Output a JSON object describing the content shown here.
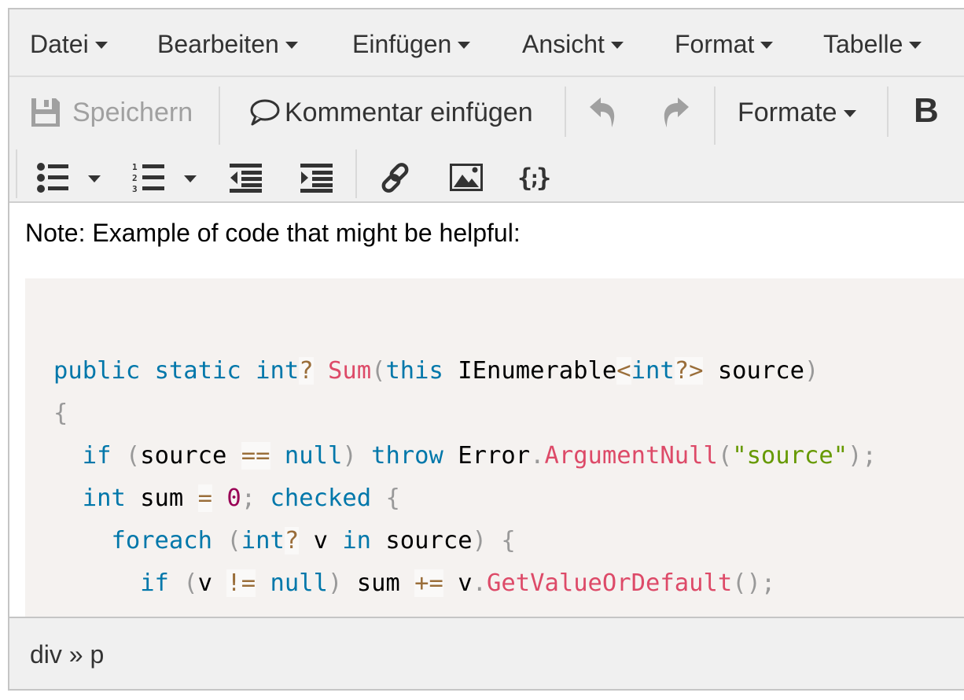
{
  "menubar": {
    "items": [
      {
        "label": "Datei"
      },
      {
        "label": "Bearbeiten"
      },
      {
        "label": "Einfügen"
      },
      {
        "label": "Ansicht"
      },
      {
        "label": "Format"
      },
      {
        "label": "Tabelle"
      }
    ]
  },
  "toolbar": {
    "save_label": "Speichern",
    "save_icon": "floppy-disk-icon",
    "comment_label": "Kommentar einfügen",
    "comment_icon": "speech-bubble-icon",
    "undo_icon": "undo-icon",
    "redo_icon": "redo-icon",
    "formats_label": "Formate",
    "bold_label": "B",
    "row2": [
      "bullet-list-icon",
      "numbered-list-icon",
      "outdent-icon",
      "indent-icon",
      "link-icon",
      "image-icon",
      "code-sample-icon"
    ]
  },
  "content": {
    "note": "Note: Example of code that might be helpful:",
    "code_lines": [
      "public static int? Sum(this IEnumerable<int?> source)",
      "{",
      "  if (source == null) throw Error.ArgumentNull(\"source\");",
      "  int sum = 0; checked {",
      "    foreach (int? v in source) {",
      "      if (v != null) sum += v.GetValueOrDefault();"
    ]
  },
  "statusbar": {
    "path": "div » p"
  },
  "colors": {
    "keyword": "#0077aa",
    "function": "#dd4a68",
    "punctuation": "#999999",
    "operator": "#9a6e3a",
    "string": "#669900",
    "number": "#990055",
    "code_background": "#f5f2f0",
    "toolbar_background": "#f0f0f0"
  }
}
